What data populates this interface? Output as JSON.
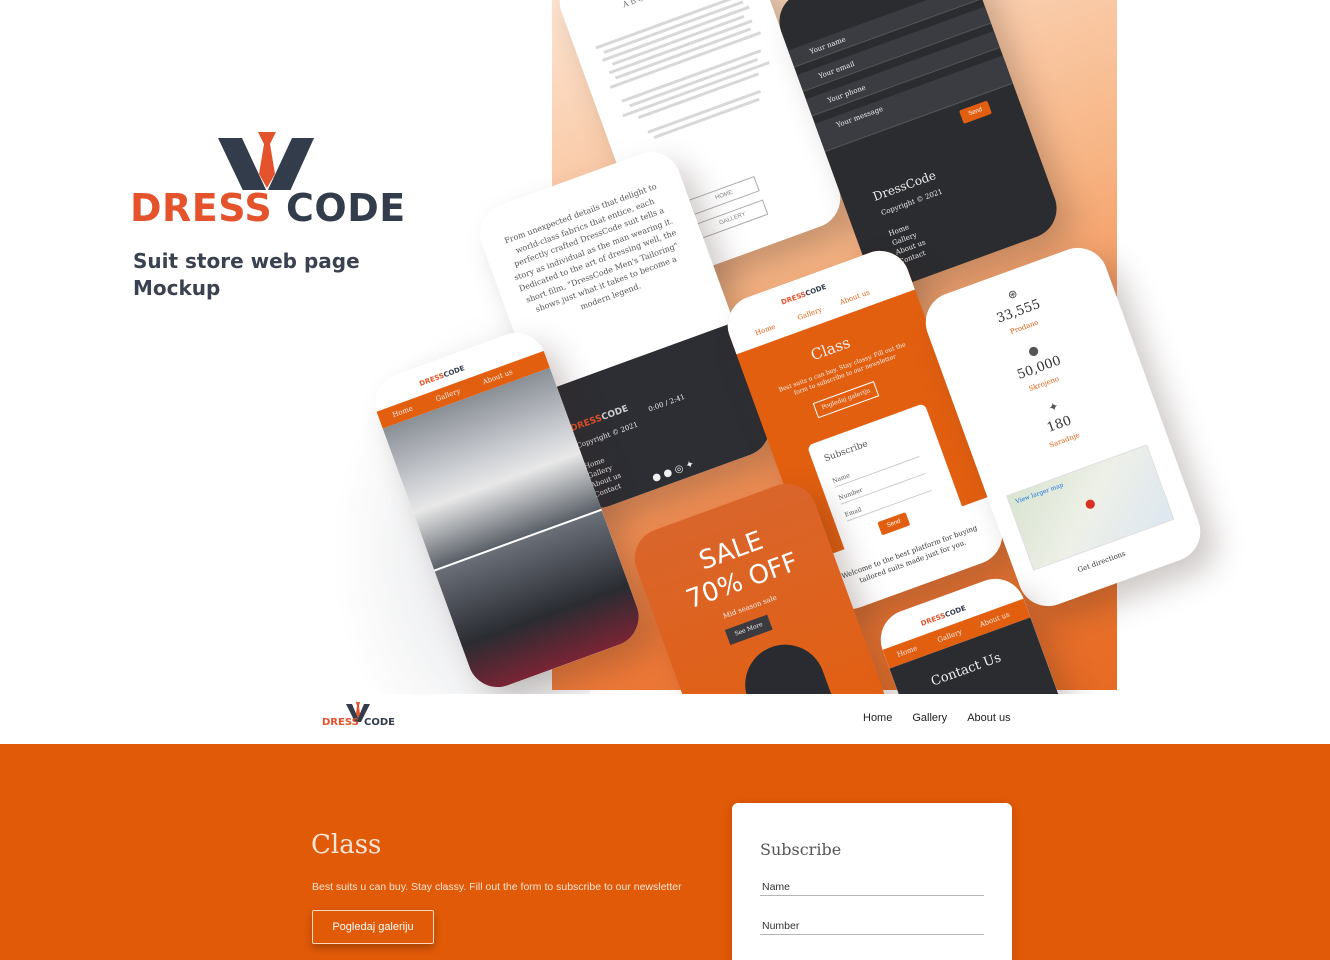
{
  "hero": {
    "brand_dress": "DRESS",
    "brand_code": "CODE",
    "tagline": "Suit store web page Mockup"
  },
  "mockups": {
    "about": {
      "heading": "ABOUT US",
      "button_home": "HOME",
      "button_gallery": "GALLERY"
    },
    "contact_dark": {
      "field_name": "Your name",
      "field_email": "Your email",
      "field_phone": "Your phone",
      "field_message": "Your message",
      "send": "Send",
      "footer_title": "DressCode",
      "copyright": "Copyright © 2021",
      "links": [
        "Home",
        "Gallery",
        "About us",
        "Contact"
      ]
    },
    "story": {
      "text": "From unexpected details that delight to world-class fabrics that entice, each perfectly crafted DressCode suit tells a story as individual as the man wearing it. Dedicated to the art of dressing well, the short film, \"DressCode Men's Tailoring\" shows just what it takes to become a modern legend.",
      "copyright": "Copyright © 2021",
      "time": "0:00 / 2:41",
      "links": [
        "Home",
        "Gallery",
        "About us",
        "Contact"
      ]
    },
    "gallery": {
      "nav": [
        "Home",
        "Gallery",
        "About us"
      ]
    },
    "class": {
      "nav": [
        "Home",
        "Gallery",
        "About us"
      ],
      "title": "Class",
      "desc": "Best suits u can buy. Stay classy. Fill out the form to subscribe to our newsletter",
      "button": "Pogledaj galeriju",
      "subscribe": "Subscribe",
      "fields": [
        "Name",
        "Number",
        "Email"
      ],
      "send": "Send",
      "welcome": "Welcome to the best platform for buying tailored suits made just for you."
    },
    "stats": {
      "items": [
        {
          "value": "33,555",
          "label": "Prodano"
        },
        {
          "value": "50,000",
          "label": "Skrojeno"
        },
        {
          "value": "180",
          "label": "Saradnje"
        }
      ],
      "map_link": "View larger map",
      "directions": "Get directions"
    },
    "sale": {
      "line1": "SALE",
      "line2": "70% OFF",
      "sub": "Mid season sale",
      "button": "See More"
    },
    "contact2": {
      "nav": [
        "Home",
        "Gallery",
        "About us"
      ],
      "title": "Contact Us"
    }
  },
  "navbar": {
    "logo_dress": "DRESS",
    "logo_code": "CODE",
    "links": [
      "Home",
      "Gallery",
      "About us"
    ]
  },
  "section": {
    "title": "Class",
    "desc": "Best suits u can buy. Stay classy. Fill out the form to subscribe to our newsletter",
    "button": "Pogledaj galeriju"
  },
  "subscribe": {
    "title": "Subscribe",
    "name_placeholder": "Name",
    "number_placeholder": "Number"
  },
  "colors": {
    "accent": "#e15a08",
    "brand_red": "#e4532b",
    "brand_navy": "#323c4b"
  }
}
